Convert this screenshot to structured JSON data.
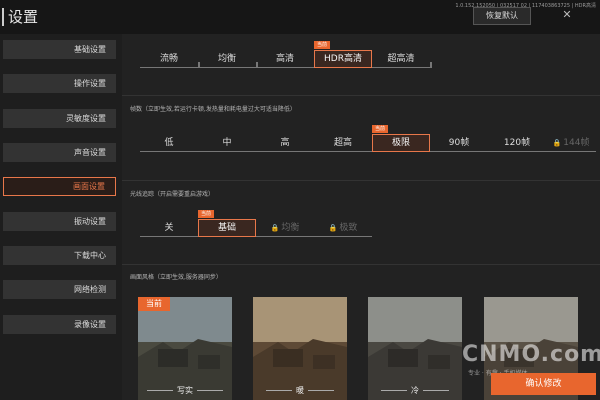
{
  "header": {
    "title": "设置",
    "version": "1.0.152.152050 | 032517 02 | 117403863725 | HDR高清",
    "reset_label": "恢复默认",
    "close_icon": "close-icon"
  },
  "sidebar": {
    "items": [
      {
        "label": "基础设置"
      },
      {
        "label": "操作设置"
      },
      {
        "label": "灵敏度设置"
      },
      {
        "label": "声音设置"
      },
      {
        "label": "画面设置",
        "active": true
      },
      {
        "label": "振动设置"
      },
      {
        "label": "下载中心"
      },
      {
        "label": "网络检测"
      },
      {
        "label": "录像设置"
      }
    ]
  },
  "quality": {
    "badge": "当前",
    "options": [
      "流畅",
      "均衡",
      "高清",
      "HDR高清",
      "超高清"
    ],
    "selected": "HDR高清"
  },
  "framerate": {
    "title": "帧数（立即生效,若运行卡顿,发热量和耗电量过大可适当降低）",
    "badge": "当前",
    "options": [
      "低",
      "中",
      "高",
      "超高",
      "极限",
      "90帧",
      "120帧",
      "144帧"
    ],
    "selected": "极限",
    "disabled": [
      "144帧"
    ]
  },
  "raytracing": {
    "title": "光线追踪（开启需要重启游戏）",
    "badge": "当前",
    "options": [
      "关",
      "基础",
      "均衡",
      "极致"
    ],
    "selected": "基础",
    "disabled": [
      "均衡",
      "极致"
    ]
  },
  "style": {
    "title": "画面风格（立即生效,服务器同步）",
    "current_badge": "当前",
    "cards": [
      {
        "label": "写实",
        "tint": "#6b6a5a"
      },
      {
        "label": "暖",
        "tint": "#8a6a4a"
      },
      {
        "label": "冷",
        "tint": "#4f5c66"
      },
      {
        "label": "",
        "tint": "#7a6e5c"
      }
    ]
  },
  "apply_label": "确认修改",
  "watermark": {
    "main": "CNMO.com",
    "sub": "专业 · 有趣 · 手机媒体"
  },
  "colors": {
    "accent": "#e8662e",
    "selected_border": "#e8774a"
  }
}
